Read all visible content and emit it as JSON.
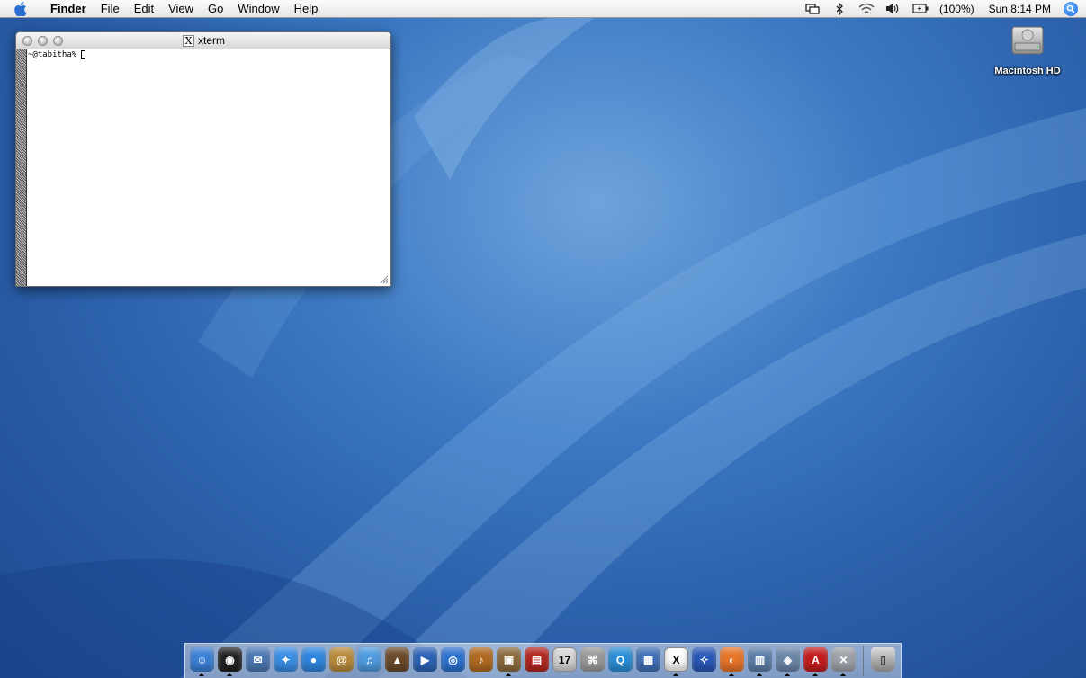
{
  "menubar": {
    "app_name": "Finder",
    "menus": [
      "File",
      "Edit",
      "View",
      "Go",
      "Window",
      "Help"
    ],
    "battery": "(100%)",
    "clock": "Sun 8:14 PM",
    "icons": [
      "apple-icon",
      "display-mirror-icon",
      "bluetooth-icon",
      "wifi-icon",
      "volume-icon",
      "battery-icon",
      "spotlight-icon"
    ]
  },
  "xterm": {
    "title": "xterm",
    "title_icon": "X",
    "prompt": "~@tabitha%"
  },
  "desktop": {
    "hd_label": "Macintosh HD"
  },
  "dock": {
    "items": [
      {
        "name": "finder",
        "glyph": "☺",
        "color": "#3b7fd6",
        "running": true
      },
      {
        "name": "dashboard",
        "glyph": "◉",
        "color": "#222222",
        "running": true
      },
      {
        "name": "mail-preview",
        "glyph": "✉",
        "color": "#4b78b4",
        "running": false
      },
      {
        "name": "safari",
        "glyph": "✦",
        "color": "#3a8ee6",
        "running": false
      },
      {
        "name": "ichat",
        "glyph": "●",
        "color": "#2f86e0",
        "running": false
      },
      {
        "name": "address-book",
        "glyph": "@",
        "color": "#b88b3c",
        "running": false
      },
      {
        "name": "itunes",
        "glyph": "♫",
        "color": "#4f9be0",
        "running": false
      },
      {
        "name": "iphoto",
        "glyph": "▲",
        "color": "#6a4a2a",
        "running": false
      },
      {
        "name": "imovie",
        "glyph": "▶",
        "color": "#2d63b7",
        "running": false
      },
      {
        "name": "idvd",
        "glyph": "◎",
        "color": "#2d72d0",
        "running": false
      },
      {
        "name": "garageband",
        "glyph": "♪",
        "color": "#b06a22",
        "running": false
      },
      {
        "name": "iweb",
        "glyph": "▣",
        "color": "#8b6b3d",
        "running": true
      },
      {
        "name": "keynote-like",
        "glyph": "▤",
        "color": "#b3261e",
        "running": false
      },
      {
        "name": "ical",
        "glyph": "17",
        "color": "#d8d8d8",
        "running": false
      },
      {
        "name": "system-preferences",
        "glyph": "⌘",
        "color": "#9a9a9a",
        "running": false
      },
      {
        "name": "quicktime",
        "glyph": "Q",
        "color": "#2a8ed8",
        "running": false
      },
      {
        "name": "network",
        "glyph": "▦",
        "color": "#3f6fb5",
        "running": false
      },
      {
        "name": "x11",
        "glyph": "X",
        "color": "#ffffff",
        "running": true
      },
      {
        "name": "thunderbird-like",
        "glyph": "✧",
        "color": "#2a58b8",
        "running": false
      },
      {
        "name": "firefox",
        "glyph": "◐",
        "color": "#e8752a",
        "running": true
      },
      {
        "name": "network-utility",
        "glyph": "▥",
        "color": "#5b7ea8",
        "running": true
      },
      {
        "name": "preview",
        "glyph": "◈",
        "color": "#6a86a8",
        "running": true
      },
      {
        "name": "acrobat",
        "glyph": "A",
        "color": "#c41d1d",
        "running": true
      },
      {
        "name": "utility",
        "glyph": "✕",
        "color": "#9fa4aa",
        "running": true
      }
    ],
    "trash_glyph": "▯"
  }
}
